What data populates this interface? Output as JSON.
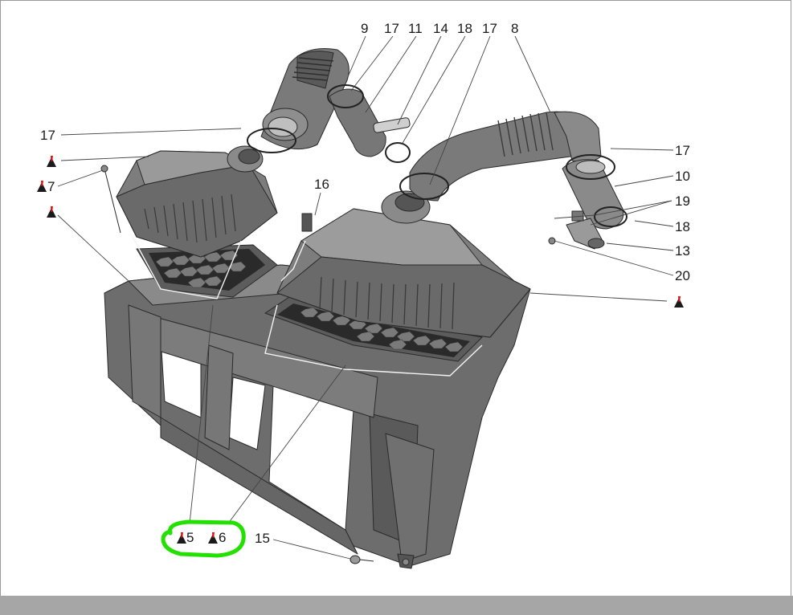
{
  "callouts": {
    "c9": "9",
    "c17a": "17",
    "c11": "11",
    "c14": "14",
    "c18a": "18",
    "c17b": "17",
    "c8": "8",
    "c17c": "17",
    "c1a": "1",
    "c7": "7",
    "c1b": "1",
    "c16": "16",
    "c17d": "17",
    "c10": "10",
    "c19": "19",
    "c18b": "18",
    "c13": "13",
    "c20": "20",
    "c1c": "1",
    "c5": "5",
    "c6": "6",
    "c15": "15"
  },
  "warning_marker_colors": {
    "triangle": "#1a1a1a",
    "mark": "#e01010"
  },
  "highlight_color": "#22e000"
}
